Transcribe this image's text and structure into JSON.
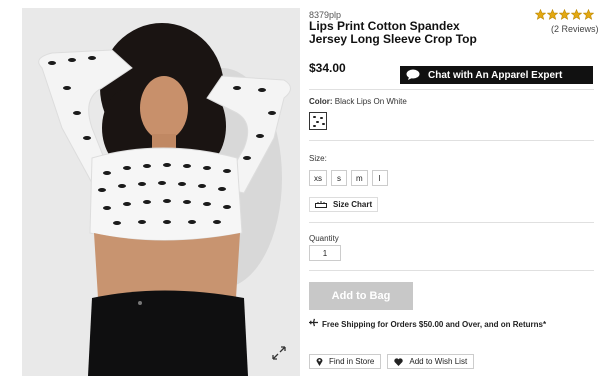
{
  "product": {
    "sku": "8379plp",
    "title": "Lips Print Cotton Spandex Jersey Long Sleeve Crop Top",
    "price": "$34.00",
    "rating": 5,
    "reviews": "(2 Reviews)"
  },
  "chat": {
    "label": "Chat with An Apparel Expert",
    "icon": "chat-bubble-icon"
  },
  "color": {
    "label": "Color:",
    "value": "Black Lips On White"
  },
  "size": {
    "label": "Size:",
    "options": [
      "xs",
      "s",
      "m",
      "l"
    ],
    "chart_label": "Size Chart",
    "chart_icon": "ruler-icon"
  },
  "quantity": {
    "label": "Quantity",
    "value": "1"
  },
  "add_to_bag": "Add to Bag",
  "shipping": {
    "text": "Free Shipping for Orders $50.00 and Over, and on Returns*",
    "icon": "airplane-icon"
  },
  "actions": {
    "find_in_store": "Find in Store",
    "find_icon": "map-pin-icon",
    "wish_list": "Add to Wish List",
    "wish_icon": "heart-icon"
  },
  "colors": {
    "accent_black": "#111111",
    "disabled_gray": "#c8c8c8",
    "star_gold": "#e3a812"
  }
}
